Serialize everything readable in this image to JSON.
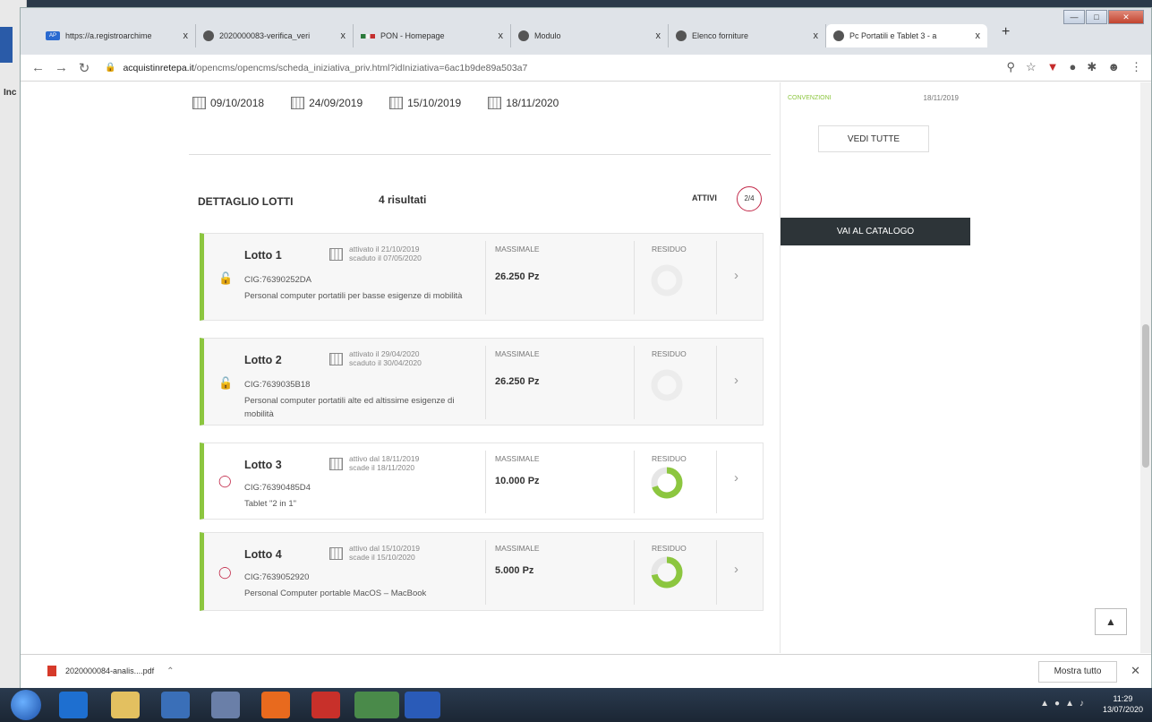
{
  "browser": {
    "tabs": [
      {
        "label": "https://a.registroarchime",
        "icon": "ap"
      },
      {
        "label": "2020000083-verifica_veri",
        "icon": "globe"
      },
      {
        "label": "PON - Homepage",
        "icon": "pon"
      },
      {
        "label": "Modulo",
        "icon": "globe"
      },
      {
        "label": "Elenco forniture",
        "icon": "globe"
      },
      {
        "label": "Pc Portatili e Tablet 3 - a",
        "icon": "globe"
      }
    ],
    "ap_icon_text": "AP",
    "close_glyph": "x",
    "new_tab": "+",
    "url_domain": "acquistinretepa.it",
    "url_path": "/opencms/opencms/scheda_iniziativa_priv.html?idIniziativa=6ac1b9de89a503a7"
  },
  "header_dates": [
    "09/10/2018",
    "24/09/2019",
    "15/10/2019",
    "18/11/2020"
  ],
  "lotti": {
    "heading": "DETTAGLIO LOTTI",
    "count": "4 risultati",
    "attivi_label": "ATTIVI",
    "attivi_value": "2/4",
    "massimale_label": "MASSIMALE",
    "residuo_label": "RESIDUO",
    "items": [
      {
        "title": "Lotto 1",
        "date1": "attivato il 21/10/2019",
        "date2": "scaduto il 07/05/2020",
        "cig": "CIG:76390252DA",
        "desc": "Personal computer portatili per basse esigenze di mobilità",
        "massimale": "26.250 Pz",
        "status": "expired",
        "residuo_fraction": 0
      },
      {
        "title": "Lotto 2",
        "date1": "attivato il 29/04/2020",
        "date2": "scaduto il 30/04/2020",
        "cig": "CIG:7639035B18",
        "desc": "Personal computer portatili alte ed altissime esigenze di mobilità",
        "massimale": "26.250 Pz",
        "status": "expired",
        "residuo_fraction": 0
      },
      {
        "title": "Lotto 3",
        "date1": "attivo dal 18/11/2019",
        "date2": "scade il 18/11/2020",
        "cig": "CIG:76390485D4",
        "desc": "Tablet \"2 in 1\"",
        "massimale": "10.000 Pz",
        "status": "active",
        "residuo_fraction": 0.7
      },
      {
        "title": "Lotto 4",
        "date1": "attivo dal 15/10/2019",
        "date2": "scade il 15/10/2020",
        "cig": "CIG:7639052920",
        "desc": "Personal Computer portable MacOS – MacBook",
        "massimale": "5.000 Pz",
        "status": "active",
        "residuo_fraction": 0.72
      }
    ]
  },
  "sidebar": {
    "convenzioni_label": "CONVENZIONI",
    "convenzioni_date": "18/11/2019",
    "vedi_tutte": "VEDI TUTTE",
    "catalogo": "VAI AL CATALOGO"
  },
  "downloads": {
    "file": "2020000084-analis....pdf",
    "mostra_tutto": "Mostra tutto"
  },
  "taskbar": {
    "time": "11:29",
    "date": "13/07/2020"
  },
  "colors": {
    "accent_green": "#8cc63f",
    "accent_red": "#c22a4a",
    "dark_button": "#2d3438"
  }
}
